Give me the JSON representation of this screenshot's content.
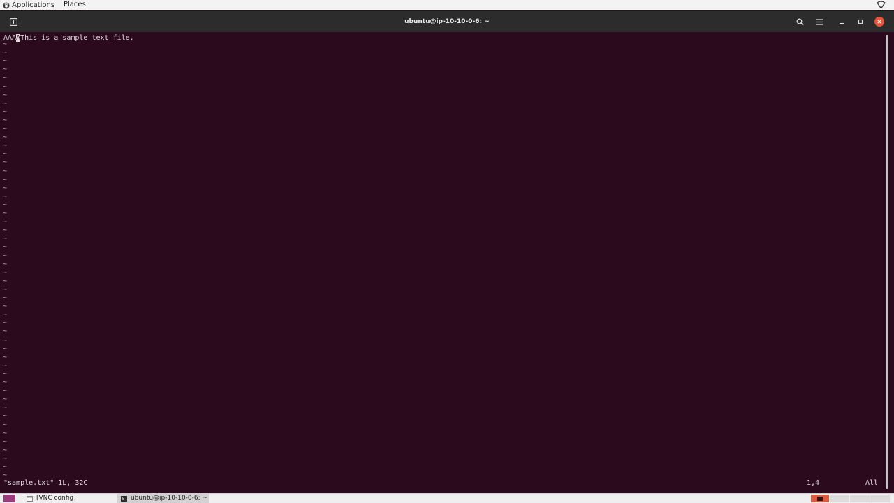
{
  "top_panel": {
    "applications_label": "Applications",
    "places_label": "Places",
    "icons": {
      "apps": "gnome-foot-icon",
      "network": "wifi-icon"
    }
  },
  "window": {
    "title": "ubuntu@ip-10-10-0-6: ~",
    "icons": {
      "new_tab": "new-tab-icon",
      "search": "search-icon",
      "menu": "hamburger-menu-icon",
      "minimize": "minimize-icon",
      "maximize": "maximize-icon",
      "close": "close-icon"
    },
    "close_color": "#e9553a"
  },
  "vim": {
    "line1_prefix": "AAA",
    "line1_cursor_char": "A",
    "line1_rest": "This is a sample text file.",
    "tilde": "~",
    "status_left": "\"sample.txt\" 1L, 32C",
    "status_position": "1,4",
    "status_percent": "All",
    "colors": {
      "background": "#2c0a1e",
      "foreground": "#e2dbe0"
    }
  },
  "taskbar": {
    "tasks": [
      {
        "label": "[VNC config]",
        "active": false,
        "icon": "window-icon"
      },
      {
        "label": "ubuntu@ip-10-10-0-6: ~",
        "active": true,
        "icon": "terminal-icon"
      }
    ],
    "workspace_accent": "#d95d3e"
  }
}
